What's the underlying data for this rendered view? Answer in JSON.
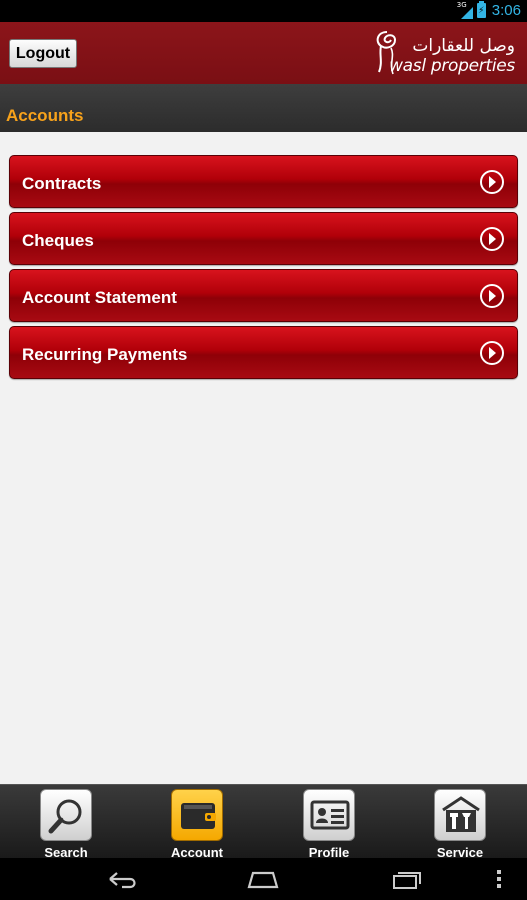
{
  "status_bar": {
    "network": "3G",
    "time": "3:06",
    "battery_icon": "battery-charging-icon"
  },
  "header": {
    "logout_label": "Logout",
    "logo_arabic": "وصل للعقارات",
    "logo_english": "wasl properties"
  },
  "page": {
    "title": "Accounts"
  },
  "menu": {
    "items": [
      {
        "label": "Contracts",
        "icon": "chevron-right-circle-icon"
      },
      {
        "label": "Cheques",
        "icon": "chevron-right-circle-icon"
      },
      {
        "label": "Account Statement",
        "icon": "chevron-right-circle-icon"
      },
      {
        "label": "Recurring Payments",
        "icon": "chevron-right-circle-icon"
      }
    ]
  },
  "tabs": [
    {
      "label": "Search",
      "icon": "magnifier-icon",
      "active": false
    },
    {
      "label": "Account",
      "icon": "wallet-icon",
      "active": true
    },
    {
      "label": "Profile",
      "icon": "id-card-icon",
      "active": false
    },
    {
      "label": "Service",
      "icon": "tools-icon",
      "active": false
    }
  ],
  "nav": {
    "back": "back-icon",
    "home": "home-icon",
    "recents": "recents-icon",
    "menu": "overflow-menu-icon"
  },
  "colors": {
    "header": "#8c151a",
    "title": "#f7a21b",
    "menu_item": "#b10009",
    "active_tab": "#f5a800",
    "status_accent": "#33b5e5"
  }
}
